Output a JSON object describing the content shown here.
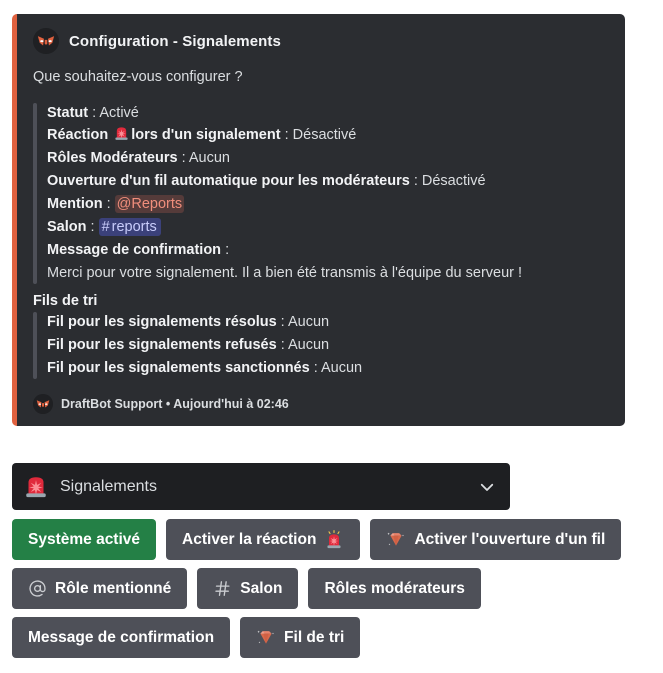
{
  "colors": {
    "embed_accent": "#e0613f",
    "embed_bg": "#2b2d31",
    "page_bg": "#ffffff",
    "button_secondary": "#4e5058",
    "button_success": "#248046",
    "select_bg": "#1e1f22",
    "role_mention": "#f08e7c",
    "channel_mention": "#c9cdfb"
  },
  "embed": {
    "author": {
      "avatar_icon": "draftbot-fox-avatar",
      "name": "Configuration - Signalements"
    },
    "description": "Que souhaitez-vous configurer ?",
    "fields": [
      {
        "key": "Statut",
        "separator": " : ",
        "value": "Activé",
        "emoji": null
      },
      {
        "key_before_emoji": "Réaction",
        "emoji": "rotating-light-emoji",
        "key_after_emoji": "lors d'un signalement",
        "separator": " : ",
        "value": "Désactivé"
      },
      {
        "key": "Rôles Modérateurs",
        "separator": " : ",
        "value": "Aucun"
      },
      {
        "key": "Ouverture d'un fil automatique pour les modérateurs",
        "separator": " : ",
        "value": "Désactivé"
      },
      {
        "key": "Mention",
        "separator": " : ",
        "value": "@Reports",
        "value_style": "role-mention"
      },
      {
        "key": "Salon",
        "separator": " : ",
        "value": "reports",
        "value_prefix": "#",
        "value_style": "channel-mention"
      },
      {
        "key": "Message de confirmation",
        "separator": " :",
        "value": ""
      }
    ],
    "confirmation_message": "Merci pour votre signalement. Il a bien été transmis à l'équipe du serveur !",
    "sort_threads": {
      "title": "Fils de tri",
      "fields": [
        {
          "key": "Fil pour les signalements résolus",
          "separator": " : ",
          "value": "Aucun"
        },
        {
          "key": "Fil pour les signalements refusés",
          "separator": " : ",
          "value": "Aucun"
        },
        {
          "key": "Fil pour les signalements sanctionnés",
          "separator": " : ",
          "value": "Aucun"
        }
      ]
    },
    "footer": {
      "icon": "draftbot-fox-avatar",
      "text": "DraftBot Support • Aujourd'hui à 02:46"
    }
  },
  "select_menu": {
    "emoji": "rotating-light-emoji",
    "selected_label": "Signalements",
    "chevron_icon": "chevron-down-icon"
  },
  "buttons": {
    "rows": [
      [
        {
          "label": "Système activé",
          "style": "success",
          "emoji": null,
          "icon": null
        },
        {
          "label": "Activer la réaction",
          "style": "secondary",
          "emoji": "rotating-light-emoji",
          "emoji_position": "after",
          "icon": null
        },
        {
          "label": "Activer l'ouverture d'un fil",
          "style": "secondary",
          "emoji": "gem-emoji",
          "emoji_position": "before",
          "icon": null
        }
      ],
      [
        {
          "label": "Rôle mentionné",
          "style": "secondary",
          "emoji": null,
          "icon": "at-sign-icon",
          "icon_position": "before"
        },
        {
          "label": "Salon",
          "style": "secondary",
          "emoji": null,
          "icon": "hash-icon",
          "icon_position": "before"
        },
        {
          "label": "Rôles modérateurs",
          "style": "secondary",
          "emoji": null,
          "icon": null
        }
      ],
      [
        {
          "label": "Message de confirmation",
          "style": "secondary",
          "emoji": null,
          "icon": null
        },
        {
          "label": "Fil de tri",
          "style": "secondary",
          "emoji": "gem-emoji",
          "emoji_position": "before",
          "icon": null
        }
      ]
    ]
  }
}
